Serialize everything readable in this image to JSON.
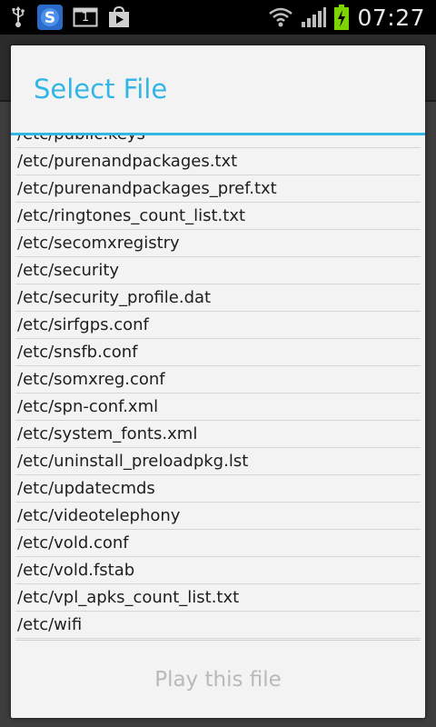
{
  "status_bar": {
    "time": "07:27",
    "icons_left": [
      "usb-icon",
      "app-s-icon",
      "calendar-icon",
      "store-icon"
    ],
    "calendar_day": "1",
    "icons_right": [
      "wifi-icon",
      "signal-icon",
      "battery-charging-icon"
    ]
  },
  "dialog": {
    "title": "Select File",
    "files": [
      "/etc/public.keys",
      "/etc/purenandpackages.txt",
      "/etc/purenandpackages_pref.txt",
      "/etc/ringtones_count_list.txt",
      "/etc/secomxregistry",
      "/etc/security",
      "/etc/security_profile.dat",
      "/etc/sirfgps.conf",
      "/etc/snsfb.conf",
      "/etc/somxreg.conf",
      "/etc/spn-conf.xml",
      "/etc/system_fonts.xml",
      "/etc/uninstall_preloadpkg.lst",
      "/etc/updatecmds",
      "/etc/videotelephony",
      "/etc/vold.conf",
      "/etc/vold.fstab",
      "/etc/vpl_apks_count_list.txt",
      "/etc/wifi"
    ],
    "action_label": "Play this file"
  },
  "colors": {
    "accent": "#33b5e5",
    "disabled_text": "#b9b9b9",
    "battery": "#7cd500"
  }
}
